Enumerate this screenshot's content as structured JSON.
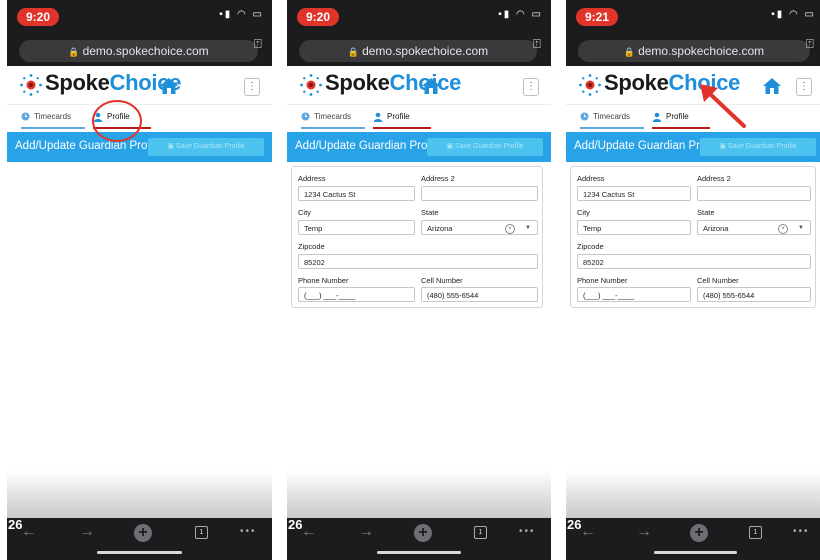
{
  "panels": [
    {
      "time": "9:20",
      "url": "demo.spokechoice.com",
      "app": {
        "brand_spoke": "Spoke",
        "brand_choice": "Choice"
      },
      "tabs": {
        "timecards": "Timecards",
        "profile": "Profile"
      },
      "header": {
        "title": "Add/Update Guardian Profile",
        "save_label": "Save Guardian Profile"
      },
      "form": null,
      "tab_count": "1",
      "overlay_number": "26"
    },
    {
      "time": "9:20",
      "url": "demo.spokechoice.com",
      "app": {
        "brand_spoke": "Spoke",
        "brand_choice": "Choice"
      },
      "tabs": {
        "timecards": "Timecards",
        "profile": "Profile"
      },
      "header": {
        "title": "Add/Update Guardian Profile",
        "save_label": "Save Guardian Profile"
      },
      "form": {
        "address_label": "Address",
        "address": "1234 Cactus St",
        "address2_label": "Address 2",
        "address2": "",
        "city_label": "City",
        "city": "Temp",
        "state_label": "State",
        "state": "Arizona",
        "zipcode_label": "Zipcode",
        "zipcode": "85202",
        "phone_label": "Phone Number",
        "phone": "(___) ___-____",
        "cell_label": "Cell Number",
        "cell": "(480) 555-6544"
      },
      "tab_count": "1",
      "overlay_number": "26"
    },
    {
      "time": "9:21",
      "url": "demo.spokechoice.com",
      "app": {
        "brand_spoke": "Spoke",
        "brand_choice": "Choice"
      },
      "tabs": {
        "timecards": "Timecards",
        "profile": "Profile"
      },
      "header": {
        "title": "Add/Update Guardian Profile",
        "save_label": "Save Guardian Profile"
      },
      "form": {
        "address_label": "Address",
        "address": "1234 Cactus St",
        "address2_label": "Address 2",
        "address2": "",
        "city_label": "City",
        "city": "Temp",
        "state_label": "State",
        "state": "Arizona",
        "zipcode_label": "Zipcode",
        "zipcode": "85202",
        "phone_label": "Phone Number",
        "phone": "(___) ___-____",
        "cell_label": "Cell Number",
        "cell": "(480) 555-6544"
      },
      "tab_count": "1",
      "overlay_number": "26"
    }
  ],
  "colors": {
    "accent_blue": "#29a3e8",
    "brand_blue": "#1e8fd8",
    "active_tab_red": "#b71c1c",
    "annotation_red": "#e0332a",
    "status_time_pill": "#e0332a"
  },
  "icons": {
    "logo": "spokechoice-burst-logo",
    "home": "home-icon",
    "timecards": "clock-icon",
    "profile": "user-icon",
    "lock": "lock-icon",
    "share": "share-icon",
    "menu": "kebab-menu-icon",
    "save": "save-icon"
  },
  "annotations": {
    "panel1": "red-circle-around-profile-tab",
    "panel3": "red-arrow-pointing-to-logo"
  }
}
